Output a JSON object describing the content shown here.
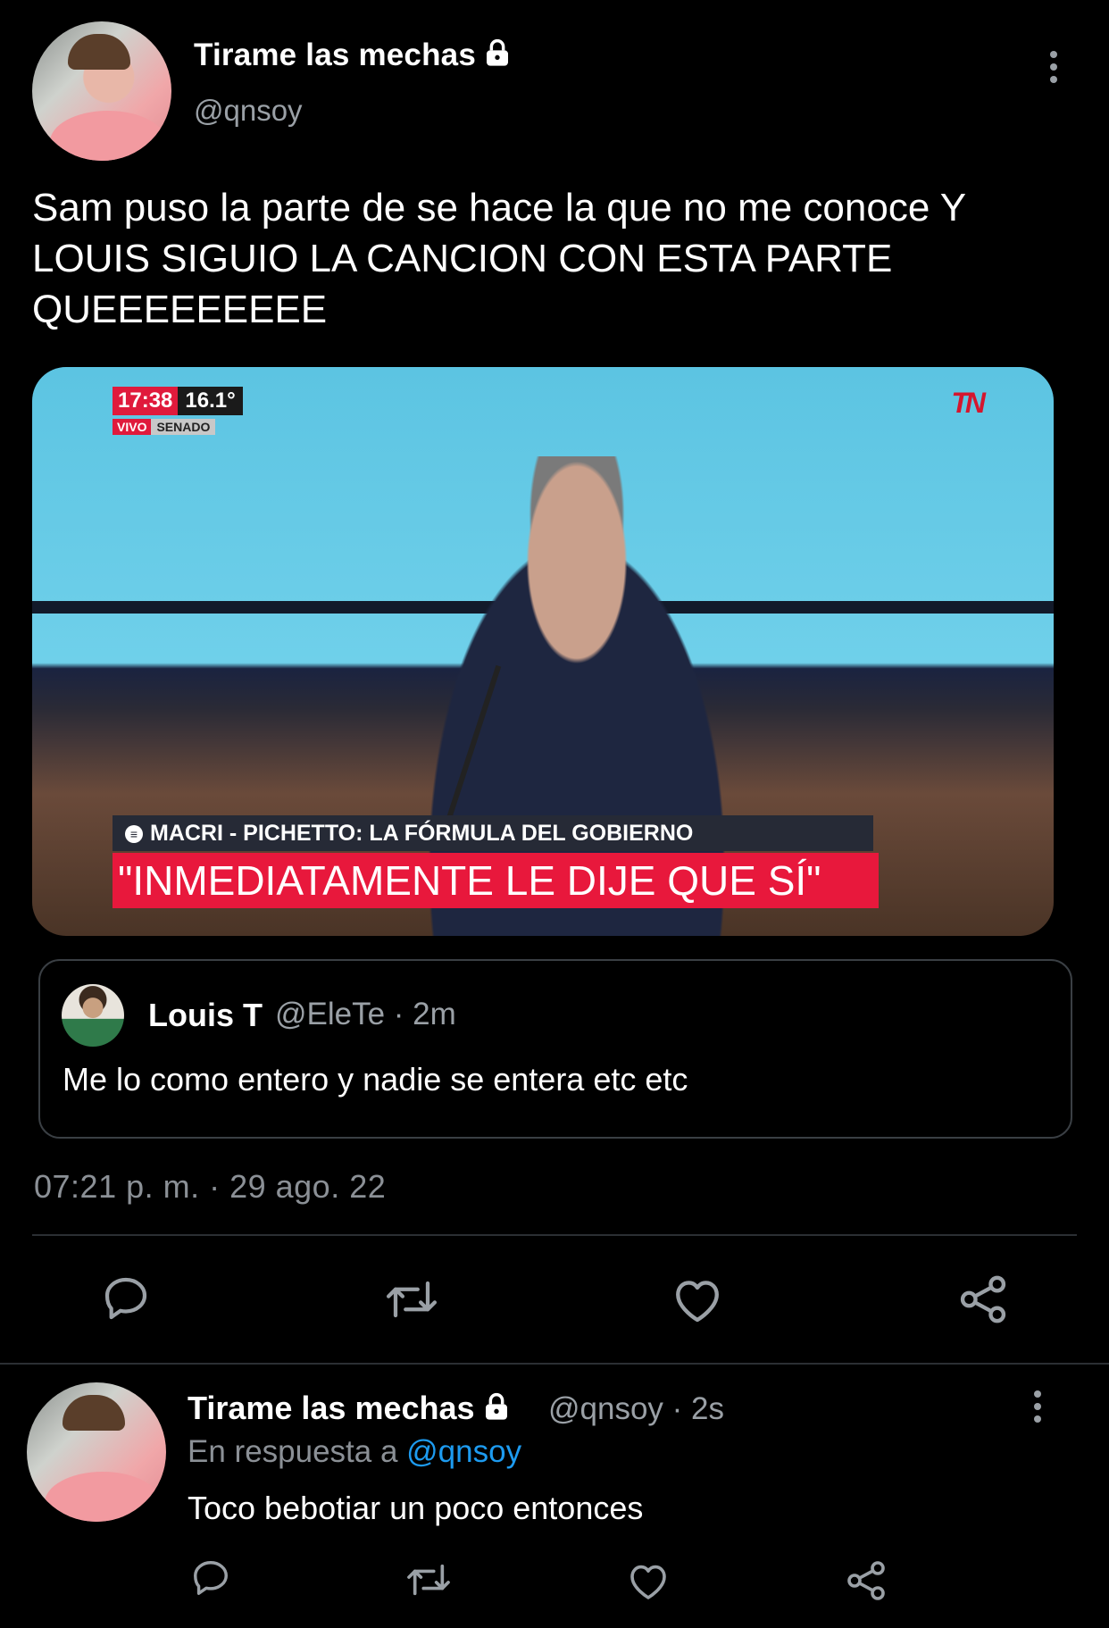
{
  "tweet": {
    "author_name": "Tirame las mechas",
    "handle": "@qnsoy",
    "text": "Sam puso la parte de se hace la que no me conoce Y LOUIS SIGUIO LA CANCION CON ESTA PARTE QUEEEEEEEEE",
    "timestamp": "07:21 p. m. · 29 ago. 22"
  },
  "media": {
    "time": "17:38",
    "temp": "16.1°",
    "live": "VIVO",
    "location": "SENADO",
    "logo": "TN",
    "headline": "MACRI - PICHETTO: LA FÓRMULA DEL GOBIERNO",
    "quote": "\"INMEDIATAMENTE LE DIJE QUE SÍ\""
  },
  "quoted_tweet": {
    "author_name": "Louis T",
    "meta": "@EleTe · 2m",
    "text": "Me lo como entero y nadie se entera etc etc"
  },
  "reply": {
    "author_name": "Tirame las mechas",
    "meta": "@qnsoy · 2s",
    "reply_prefix": "En respuesta a ",
    "reply_mention": "@qnsoy",
    "text": "Toco bebotiar un poco entonces"
  },
  "icons": {
    "reply": "reply-icon",
    "retweet": "retweet-icon",
    "like": "heart-icon",
    "share": "share-icon",
    "lock": "lock-icon",
    "more": "more-vertical-icon"
  },
  "colors": {
    "background": "#000000",
    "secondary_text": "#9aa0a6",
    "link": "#1d9bf0"
  }
}
